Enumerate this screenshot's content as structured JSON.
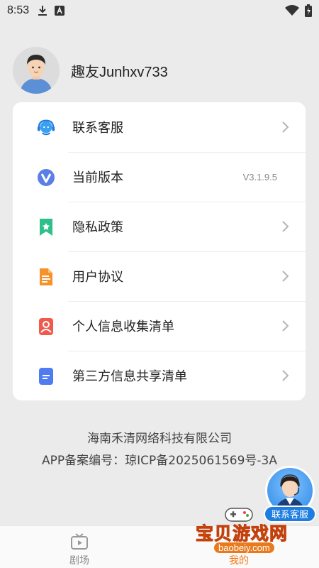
{
  "status_bar": {
    "time": "8:53",
    "icons": [
      "download-icon",
      "a-icon",
      "wifi-icon",
      "battery-icon"
    ]
  },
  "profile": {
    "username": "趣友Junhxv733",
    "avatar_icon": "user-avatar-icon"
  },
  "menu": [
    {
      "label": "联系客服",
      "icon": "headset-icon",
      "has_chevron": true
    },
    {
      "label": "当前版本",
      "icon": "version-icon",
      "value": "V3.1.9.5",
      "has_chevron": false
    },
    {
      "label": "隐私政策",
      "icon": "bookmark-shield-icon",
      "has_chevron": true
    },
    {
      "label": "用户协议",
      "icon": "document-icon",
      "has_chevron": true
    },
    {
      "label": "个人信息收集清单",
      "icon": "person-icon",
      "has_chevron": true
    },
    {
      "label": "第三方信息共享清单",
      "icon": "list-icon",
      "has_chevron": true
    }
  ],
  "footer": {
    "company": "海南禾清网络科技有限公司",
    "icp": "APP备案编号：琼ICP备2025061569号-3A"
  },
  "float_service": {
    "label": "联系客服"
  },
  "bottom_nav": [
    {
      "label": "剧场",
      "icon": "tv-icon",
      "active": false
    },
    {
      "label": "我的",
      "icon": "user-icon",
      "active": true
    }
  ],
  "watermark": {
    "text": "宝贝游戏网",
    "url": "baobeiy.com"
  },
  "colors": {
    "accent": "#f27a1a",
    "service_blue": "#1f7de0",
    "background": "#ebebeb"
  }
}
